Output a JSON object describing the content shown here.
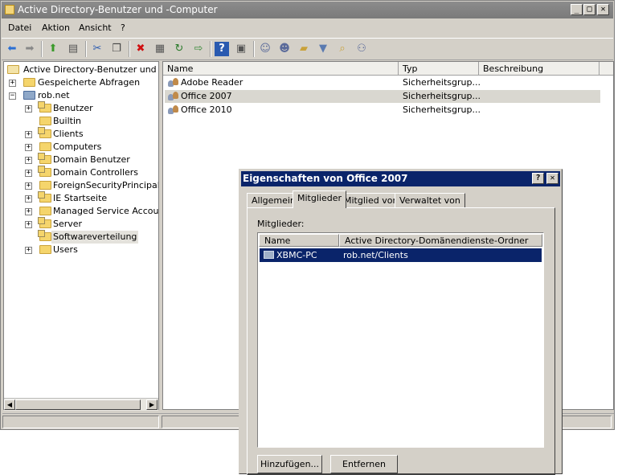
{
  "window": {
    "title": "Active Directory-Benutzer und -Computer"
  },
  "menu": [
    "Datei",
    "Aktion",
    "Ansicht",
    "?"
  ],
  "toolbar_icons": [
    "back-arrow-icon",
    "forward-arrow-icon",
    "up-folder-icon",
    "show-tree-icon",
    "cut-icon",
    "copy-icon",
    "delete-icon",
    "properties-icon",
    "refresh-icon",
    "export-icon",
    "help-icon",
    "console-icon",
    "new-user-icon",
    "new-group-icon",
    "new-ou-icon",
    "filter-icon",
    "find-icon",
    "add-to-group-icon"
  ],
  "tree": {
    "root": "Active Directory-Benutzer und -Cor",
    "saved_queries": "Gespeicherte Abfragen",
    "domain": "rob.net",
    "children": [
      "Benutzer",
      "Builtin",
      "Clients",
      "Computers",
      "Domain Benutzer",
      "Domain Controllers",
      "ForeignSecurityPrincipals",
      "IE Startseite",
      "Managed Service Accounts",
      "Server",
      "Softwareverteilung",
      "Users"
    ]
  },
  "list": {
    "headers": {
      "name": "Name",
      "type": "Typ",
      "description": "Beschreibung"
    },
    "rows": [
      {
        "name": "Adobe Reader",
        "type": "Sicherheitsgrup..."
      },
      {
        "name": "Office 2007",
        "type": "Sicherheitsgrup..."
      },
      {
        "name": "Office 2010",
        "type": "Sicherheitsgrup..."
      }
    ]
  },
  "dialog": {
    "title": "Eigenschaften von Office 2007",
    "help": "?",
    "close": "✕",
    "tabs": [
      "Allgemein",
      "Mitglieder",
      "Mitglied von",
      "Verwaltet von"
    ],
    "members_label": "Mitglieder:",
    "members_headers": {
      "name": "Name",
      "folder": "Active Directory-Domänendienste-Ordner"
    },
    "members": [
      {
        "name": "XBMC-PC",
        "folder": "rob.net/Clients"
      }
    ],
    "add_button": "Hinzufügen...",
    "remove_button": "Entfernen"
  }
}
